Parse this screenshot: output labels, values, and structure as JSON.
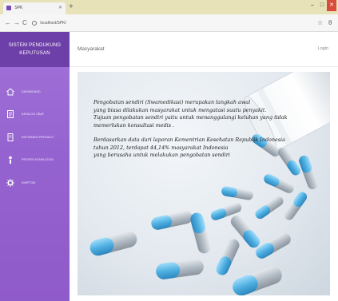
{
  "browser": {
    "tab_title": "SPK",
    "new_tab_symbol": "+",
    "window_buttons": [
      "–",
      "□",
      "✕"
    ],
    "nav_back": "←",
    "nav_forward": "→",
    "nav_reload": "C",
    "address": "localhost/SPK/",
    "star_symbol": "☆",
    "account_symbol": "θ"
  },
  "sidebar": {
    "brand_line1": "SISTEM PENDUKUNG",
    "brand_line2": "KEPUTUSAN",
    "items": [
      {
        "label": "DASHBOARD",
        "icon": "home-icon"
      },
      {
        "label": "KATALOG OBAT",
        "icon": "catalog-icon"
      },
      {
        "label": "INFORMASI PENYAKIT",
        "icon": "document-icon"
      },
      {
        "label": "PROSES KONSULTASI",
        "icon": "user-icon"
      },
      {
        "label": "SIMPTOM",
        "icon": "gear-icon"
      }
    ]
  },
  "header": {
    "title": "Masyarakat",
    "login_label": "Login"
  },
  "hero": {
    "paragraph1": [
      "Pengobatan sendiri (Swamedikasi) merupakan langkah awal",
      "yang biasa dilakukan masyarakat untuk mengatasi suatu penyakit.",
      "Tujuan pengobatan sendiri yaitu untuk menanggulangi keluhan yang tidak",
      "memerlukan konsultasi medis ."
    ],
    "paragraph2": [
      "Berdasarkan data dari laporan Kementrian Kesehatan Republik Indonesia",
      "tahun 2012, terdapat 44,14% masyarakat Indonesia",
      "yang berusaha untuk melakukan pengobatan sendiri"
    ]
  },
  "colors": {
    "sidebar": "#9563cf",
    "brand": "#6d3fa8",
    "capsule_blue": "#5cb8e6",
    "capsule_grey": "#a9b2bc"
  }
}
